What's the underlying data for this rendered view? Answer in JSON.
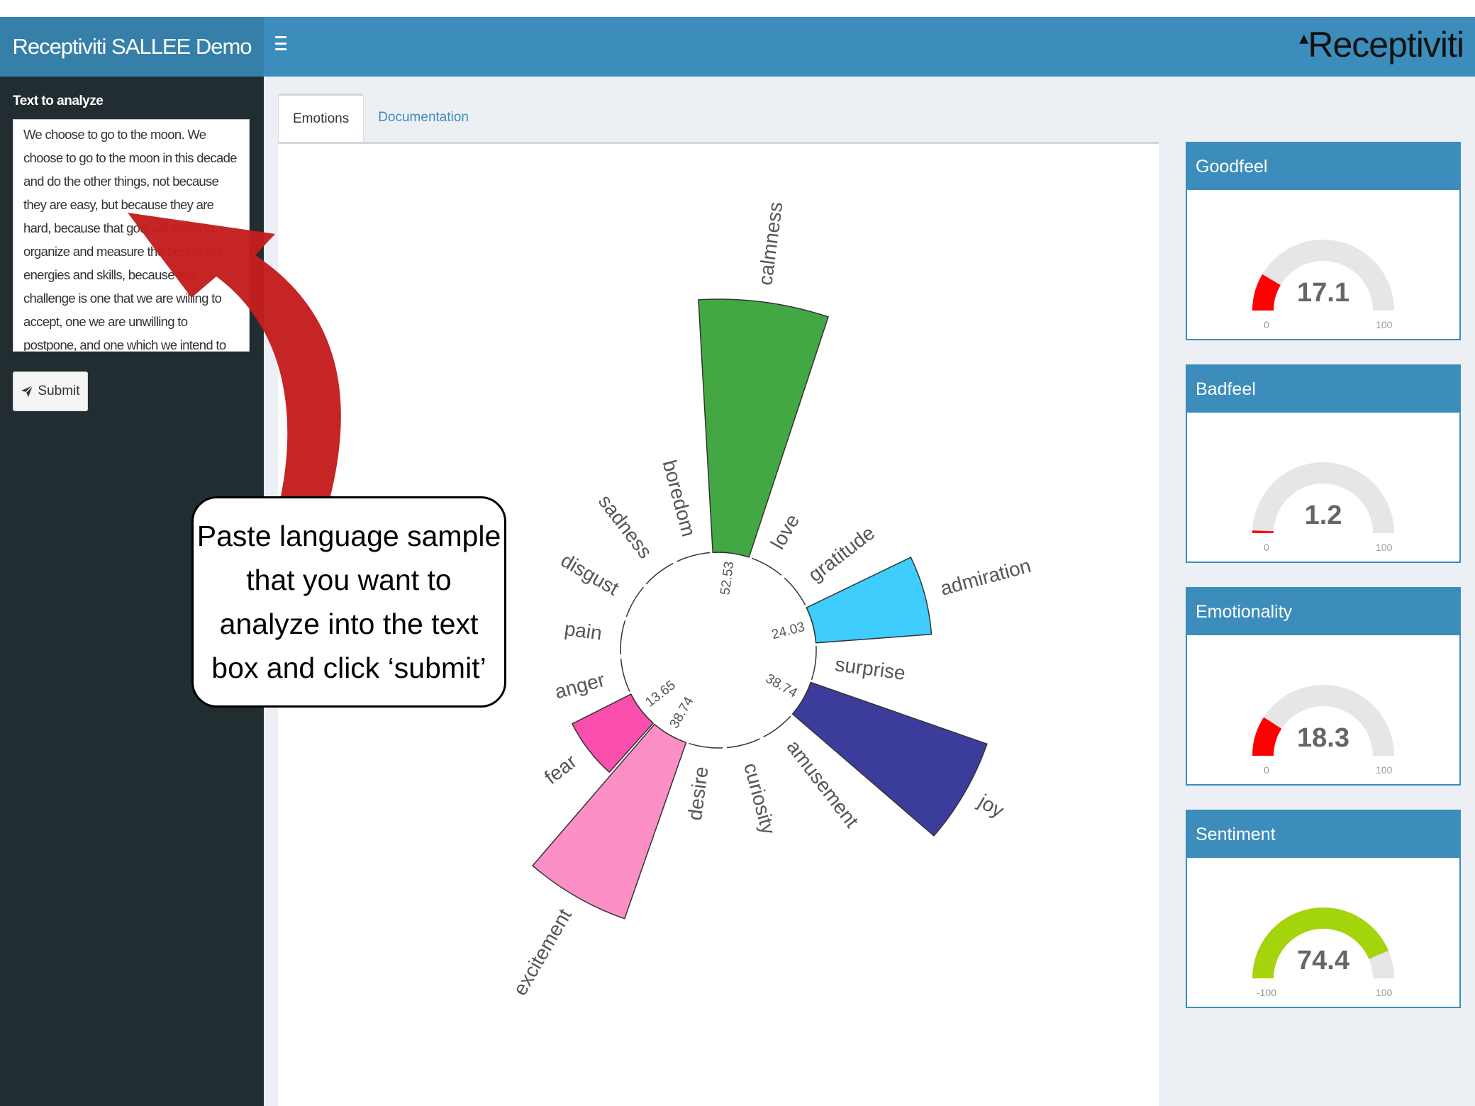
{
  "header": {
    "app_title": "Receptiviti SALLEE Demo",
    "menu_icon": "hamburger-icon",
    "logo_text": "Receptiviti"
  },
  "sidebar": {
    "input_label": "Text to analyze",
    "input_value": "We choose to go to the moon. We choose to go to the moon in this decade and do the other things, not because they are easy, but because they are hard, because that goal will serve to organize and measure the best of our energies and skills, because that challenge is one that we are willing to accept, one we are unwilling to postpone, and one which we intend to win, and the others, too.",
    "submit_label": "Submit",
    "submit_icon": "paper-plane-icon"
  },
  "tabs": [
    {
      "label": "Emotions",
      "active": true
    },
    {
      "label": "Documentation",
      "active": false
    }
  ],
  "callout": {
    "text": "Paste language sample that you want to analyze into the text box and click ‘submit’"
  },
  "chart_data": {
    "type": "radial-bar",
    "categories": [
      "calmness",
      "love",
      "gratitude",
      "admiration",
      "surprise",
      "joy",
      "amusement",
      "curiosity",
      "desire",
      "excitement",
      "fear",
      "anger",
      "pain",
      "disgust",
      "sadness",
      "boredom"
    ],
    "values": [
      52.53,
      0,
      0,
      24.03,
      0,
      38.74,
      0,
      0,
      0,
      38.74,
      13.65,
      0,
      0,
      0,
      0,
      0
    ],
    "value_labels": [
      "52.53",
      "",
      "",
      "24.03",
      "",
      "38.74",
      "",
      "",
      "",
      "38.74",
      "13.65",
      "",
      "",
      "",
      "",
      ""
    ],
    "colors": [
      "#43a843",
      "",
      "",
      "#3ecdfc",
      "",
      "#3c3c9c",
      "",
      "",
      "",
      "#fc8fc6",
      "#fb4faf",
      "",
      "",
      "",
      "",
      ""
    ],
    "scale_max": 52.53
  },
  "gauges": [
    {
      "title": "Goodfeel",
      "value": 17.1,
      "value_label": "17.1",
      "min": 0,
      "max": 100,
      "min_label": "0",
      "max_label": "100",
      "color": "#ff0000"
    },
    {
      "title": "Badfeel",
      "value": 1.2,
      "value_label": "1.2",
      "min": 0,
      "max": 100,
      "min_label": "0",
      "max_label": "100",
      "color": "#ff0000"
    },
    {
      "title": "Emotionality",
      "value": 18.3,
      "value_label": "18.3",
      "min": 0,
      "max": 100,
      "min_label": "0",
      "max_label": "100",
      "color": "#ff0000"
    },
    {
      "title": "Sentiment",
      "value": 74.4,
      "value_label": "74.4",
      "min": -100,
      "max": 100,
      "min_label": "-100",
      "max_label": "100",
      "color": "#a4d40c"
    }
  ]
}
